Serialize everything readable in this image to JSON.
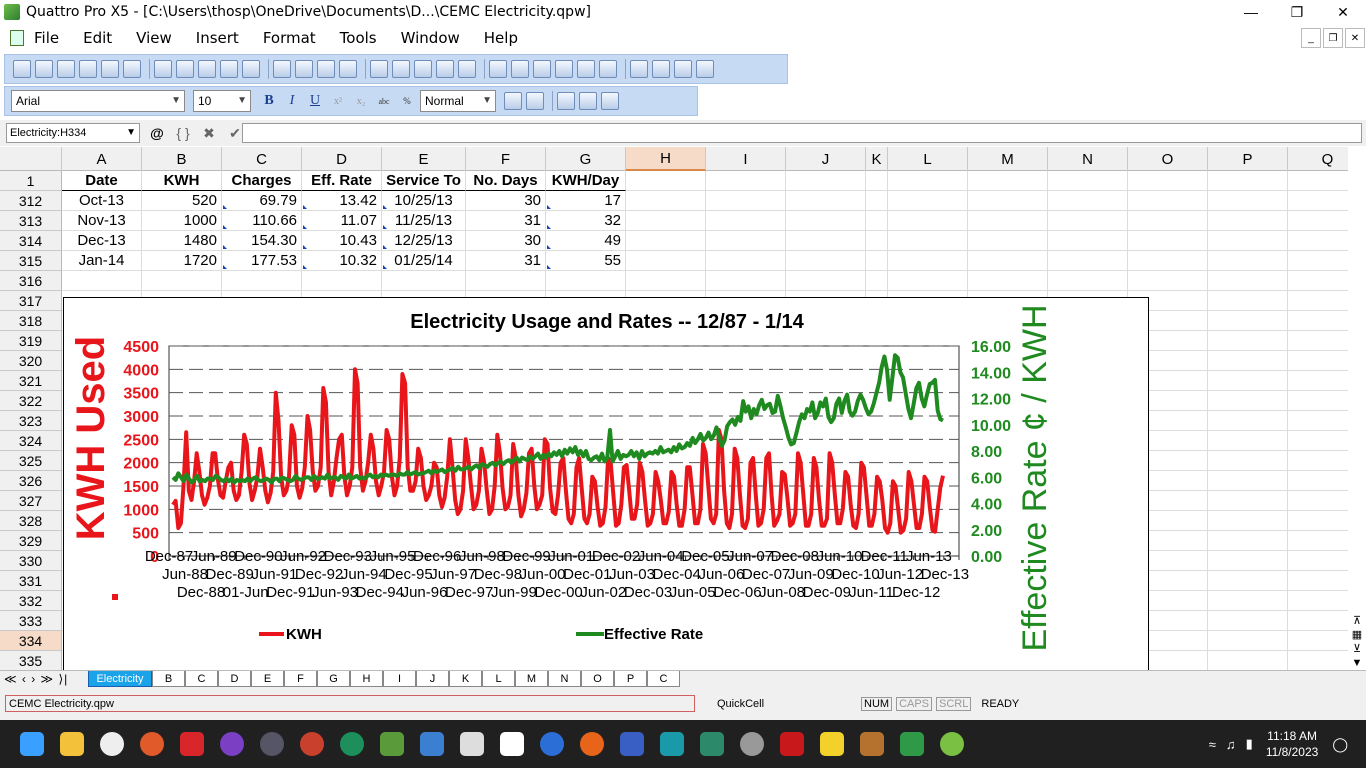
{
  "window": {
    "title": "Quattro Pro X5 - [C:\\Users\\thosp\\OneDrive\\Documents\\D...\\CEMC Electricity.qpw]"
  },
  "menu": [
    "File",
    "Edit",
    "View",
    "Insert",
    "Format",
    "Tools",
    "Window",
    "Help"
  ],
  "format_toolbar": {
    "font": "Arial",
    "size": "10",
    "style": "Normal"
  },
  "formula_bar": {
    "cell_ref": "Electricity:H334",
    "content": ""
  },
  "columns": [
    "A",
    "B",
    "C",
    "D",
    "E",
    "F",
    "G",
    "H",
    "I",
    "J",
    "K",
    "L",
    "M",
    "N",
    "O",
    "P",
    "Q"
  ],
  "selected_column": "H",
  "header_row": {
    "row": "1",
    "cells": [
      "Date",
      "KWH",
      "Charges",
      "Eff. Rate",
      "Service To",
      "No. Days",
      "KWH/Day"
    ]
  },
  "rows": [
    {
      "row": "312",
      "cells": [
        "Oct-13",
        "520",
        "69.79",
        "13.42",
        "10/25/13",
        "30",
        "17"
      ]
    },
    {
      "row": "313",
      "cells": [
        "Nov-13",
        "1000",
        "110.66",
        "11.07",
        "11/25/13",
        "31",
        "32"
      ]
    },
    {
      "row": "314",
      "cells": [
        "Dec-13",
        "1480",
        "154.30",
        "10.43",
        "12/25/13",
        "30",
        "49"
      ]
    },
    {
      "row": "315",
      "cells": [
        "Jan-14",
        "1720",
        "177.53",
        "10.32",
        "01/25/14",
        "31",
        "55"
      ]
    }
  ],
  "extra_rows": [
    "316",
    "317",
    "318",
    "319",
    "320",
    "321",
    "322",
    "323",
    "324",
    "325",
    "326",
    "327",
    "328",
    "329",
    "330",
    "331",
    "332",
    "333",
    "334",
    "335"
  ],
  "selected_row": "334",
  "chart_data": {
    "type": "line",
    "title": "Electricity Usage and Rates -- 12/87 - 1/14",
    "ylabel": "KWH Used",
    "y2label": "Effective Rate  ¢ / KWH",
    "ylim": [
      0,
      4500
    ],
    "y2lim": [
      0,
      16
    ],
    "yticks": [
      "0",
      "500",
      "1000",
      "1500",
      "2000",
      "2500",
      "3000",
      "3500",
      "4000",
      "4500"
    ],
    "y2ticks": [
      "0.00",
      "2.00",
      "4.00",
      "6.00",
      "8.00",
      "10.00",
      "12.00",
      "14.00",
      "16.00"
    ],
    "xtick_rows": [
      [
        "Dec-87",
        "Jun-89",
        "Dec-90",
        "Jun-92",
        "Dec-93",
        "Jun-95",
        "Dec-96",
        "Jun-98",
        "Dec-99",
        "Jun-01",
        "Dec-02",
        "Jun-04",
        "Dec-05",
        "Jun-07",
        "Dec-08",
        "Jun-10",
        "Dec-11",
        "Jun-13"
      ],
      [
        "Jun-88",
        "Dec-89",
        "Jun-91",
        "Dec-92",
        "Jun-94",
        "Dec-95",
        "Jun-97",
        "Dec-98",
        "Jun-00",
        "Dec-01",
        "Jun-03",
        "Dec-04",
        "Jun-06",
        "Dec-07",
        "Jun-09",
        "Dec-10",
        "Jun-12",
        "Dec-13"
      ],
      [
        "Dec-88",
        "Jun-90",
        "Dec-91",
        "Jun-93",
        "Dec-94",
        "Jun-96",
        "Dec-97",
        "Jun-99",
        "Dec-00",
        "Jun-02",
        "Dec-03",
        "Jun-05",
        "Dec-06",
        "Jun-08",
        "Dec-09",
        "Jun-11",
        "Dec-12"
      ]
    ],
    "xtick_rows_shown": [
      [
        "Dec-87",
        "Jun-89",
        "Dec-90",
        "Jun-92",
        "Dec-93",
        "Jun-95",
        "Dec-96",
        "Jun-98",
        "Dec-99",
        "Jun-01",
        "Dec-02",
        "Jun-04",
        "Dec-05",
        "Jun-07",
        "Dec-08",
        "Jun-10",
        "Dec-11",
        "Jun-13"
      ],
      [
        "Jun-88",
        "Dec-89",
        "Jun-91",
        "Dec-92",
        "Jun-94",
        "Dec-95",
        "Jun-97",
        "Dec-98",
        "Jun-00",
        "Dec-01",
        "Jun-03",
        "Dec-04",
        "Jun-06",
        "Dec-07",
        "Jun-09",
        "Dec-10",
        "Jun-12",
        "Dec-13"
      ],
      [
        "Dec-88",
        "01-Jun",
        "Dec-91",
        "Jun-93",
        "Dec-94",
        "Jun-96",
        "Dec-97",
        "Jun-99",
        "Dec-00",
        "Jun-02",
        "Dec-03",
        "Jun-05",
        "Dec-06",
        "Jun-08",
        "Dec-09",
        "Jun-11",
        "Dec-12"
      ]
    ],
    "legend": "bottom",
    "grid": true,
    "series": [
      {
        "name": "KWH",
        "color": "#e8151b",
        "axis": "left",
        "x_start": "Dec-87",
        "x_end": "Jan-14",
        "values": [
          1100,
          1180,
          600,
          700,
          1500,
          2650,
          1400,
          1200,
          1600,
          2200,
          1800,
          1300,
          1100,
          1250,
          1500,
          2200,
          2200,
          1650,
          1300,
          1250,
          1600,
          1900,
          2000,
          1400,
          1200,
          1300,
          1800,
          2600,
          2400,
          1550,
          1200,
          1400,
          1700,
          2300,
          1900,
          1400,
          1150,
          1350,
          1800,
          3500,
          2900,
          1700,
          1300,
          1400,
          1700,
          2800,
          2600,
          1500,
          1250,
          1450,
          1900,
          3000,
          2700,
          1800,
          1400,
          1500,
          1900,
          3600,
          3300,
          1800,
          1300,
          1600,
          2100,
          2500,
          2600,
          1700,
          1300,
          1500,
          1900,
          4000,
          3700,
          1900,
          1400,
          1600,
          2000,
          2600,
          2300,
          1600,
          1300,
          1500,
          1800,
          2700,
          2500,
          1700,
          1300,
          1500,
          2100,
          3900,
          3700,
          1900,
          1400,
          1400,
          1600,
          2300,
          2100,
          1500,
          1200,
          1300,
          1500,
          2000,
          1900,
          1300,
          1050,
          1250,
          1700,
          2500,
          1900,
          1200,
          900,
          1000,
          1400,
          2500,
          2100,
          1500,
          1000,
          1100,
          1400,
          2300,
          2000,
          1400,
          900,
          1000,
          1500,
          2600,
          2200,
          1450,
          1000,
          1050,
          1300,
          2400,
          2100,
          1300,
          850,
          1000,
          1350,
          2200,
          2300,
          1500,
          1000,
          1100,
          1300,
          2500,
          2400,
          1450,
          950,
          900,
          1300,
          2000,
          2100,
          1400,
          800,
          700,
          900,
          1900,
          2100,
          1450,
          800,
          700,
          900,
          1700,
          1600,
          1050,
          650,
          700,
          1050,
          2100,
          2000,
          1300,
          650,
          700,
          1100,
          1900,
          1950,
          1400,
          800,
          800,
          1100,
          2000,
          1800,
          1200,
          650,
          700,
          900,
          1800,
          1600,
          1200,
          700,
          700,
          950,
          1800,
          1700,
          1100,
          650,
          650,
          1000,
          1900,
          1900,
          1300,
          700,
          700,
          1000,
          2400,
          2200,
          1500,
          800,
          700,
          900,
          2700,
          2500,
          1400,
          700,
          600,
          900,
          2300,
          2100,
          1300,
          650,
          600,
          800,
          2000,
          2100,
          1300,
          650,
          700,
          1000,
          2100,
          2200,
          1300,
          650,
          750,
          900,
          1800,
          1750,
          1250,
          650,
          700,
          900,
          2200,
          2000,
          1350,
          650,
          650,
          900,
          2100,
          1900,
          1200,
          650,
          650,
          800,
          2200,
          2000,
          1300,
          700,
          700,
          1000,
          1800,
          1700,
          1100,
          650,
          600,
          900,
          2000,
          1900,
          1300,
          650,
          650,
          900,
          1700,
          1600,
          1200,
          600,
          500,
          700,
          1600,
          1500,
          1000,
          500,
          550,
          800,
          1800,
          1600,
          1100,
          600,
          600,
          900,
          1700,
          1600,
          1050,
          550,
          520,
          1000,
          1480,
          1720
        ]
      },
      {
        "name": "Effective Rate",
        "color": "#1f8a1f",
        "axis": "right",
        "x_start": "Dec-87",
        "x_end": "Jan-14",
        "values": [
          6.0,
          5.8,
          6.3,
          6.0,
          5.7,
          6.2,
          5.9,
          5.6,
          5.8,
          6.1,
          5.7,
          5.8,
          5.7,
          5.9,
          5.9,
          5.8,
          6.1,
          6.0,
          5.8,
          5.7,
          5.9,
          5.7,
          5.9,
          5.6,
          5.8,
          5.7,
          5.8,
          5.7,
          5.9,
          5.7,
          5.9,
          6.0,
          5.8,
          5.7,
          5.8,
          5.9,
          5.8,
          5.6,
          5.9,
          5.9,
          5.7,
          6.0,
          5.9,
          5.8,
          5.7,
          5.8,
          6.1,
          5.9,
          5.8,
          5.9,
          6.0,
          6.0,
          5.8,
          6.1,
          5.9,
          5.9,
          6.0,
          5.9,
          6.2,
          5.9,
          6.0,
          6.0,
          5.8,
          6.1,
          6.0,
          5.9,
          6.2,
          5.9,
          6.0,
          6.1,
          5.9,
          6.0,
          5.9,
          6.1,
          6.2,
          6.0,
          6.1,
          6.0,
          6.2,
          6.1,
          6.2,
          6.1,
          6.2,
          6.2,
          6.1,
          6.3,
          6.2,
          6.2,
          6.4,
          6.2,
          6.3,
          6.4,
          6.2,
          6.3,
          6.3,
          6.4,
          6.5,
          6.3,
          6.5,
          6.4,
          6.5,
          6.6,
          6.4,
          6.5,
          6.6,
          6.7,
          6.5,
          6.8,
          6.6,
          6.6,
          6.7,
          6.8,
          6.6,
          6.8,
          6.9,
          6.7,
          7.0,
          6.9,
          6.8,
          7.0,
          7.1,
          6.9,
          7.1,
          7.2,
          7.0,
          7.2,
          7.3,
          7.1,
          7.3,
          7.5,
          7.2,
          7.5,
          7.4,
          7.3,
          7.6,
          7.4,
          7.6,
          7.8,
          7.4,
          7.7,
          7.5,
          7.8,
          7.6,
          7.9,
          7.7,
          8.0,
          7.6,
          8.1,
          7.8,
          8.2,
          7.9,
          8.3,
          7.7,
          8.0,
          7.6,
          8.0,
          7.4,
          7.3,
          7.5,
          7.6,
          7.3,
          7.8,
          7.2,
          7.5,
          9.6,
          7.2,
          7.6,
          8.0,
          7.4,
          7.7,
          7.6,
          7.7,
          8.0,
          7.6,
          7.9,
          7.4,
          8.0,
          7.6,
          7.8,
          7.9,
          7.8,
          8.0,
          7.8,
          8.3,
          7.9,
          8.0,
          8.1,
          7.9,
          8.3,
          8.0,
          8.5,
          8.2,
          8.3,
          8.6,
          8.4,
          9.0,
          8.6,
          8.9,
          9.3,
          8.8,
          9.0,
          9.4,
          8.9,
          9.2,
          9.8,
          9.0,
          8.4,
          8.8,
          9.9,
          10.2,
          10.4,
          10.0,
          10.6,
          10.3,
          11.8,
          11.0,
          11.4,
          10.5,
          11.2,
          10.8,
          11.5,
          11.9,
          11.2,
          11.5,
          11.6,
          10.9,
          11.0,
          12.2,
          11.4,
          10.5,
          9.8,
          9.0,
          8.5,
          8.6,
          9.4,
          10.2,
          10.8,
          10.5,
          11.2,
          11.0,
          11.7,
          10.5,
          10.9,
          11.7,
          11.4,
          12.0,
          10.6,
          10.2,
          10.5,
          11.6,
          12.0,
          10.9,
          11.8,
          12.3,
          11.0,
          10.7,
          11.0,
          11.8,
          12.3,
          11.9,
          11.3,
          10.8,
          11.0,
          11.6,
          12.4,
          13.2,
          14.4,
          15.2,
          14.2,
          11.9,
          13.6,
          15.3,
          15.1,
          14.0,
          13.6,
          12.4,
          11.2,
          10.5,
          11.6,
          12.8,
          13.2,
          12.0,
          11.4,
          12.3,
          13.1,
          13.2,
          13.42,
          11.07,
          10.43,
          10.32
        ]
      }
    ]
  },
  "sheet_nav": "≪ ‹ › ≫ ⟩|",
  "tabs": [
    "Electricity",
    "B",
    "C",
    "D",
    "E",
    "F",
    "G",
    "H",
    "I",
    "J",
    "K",
    "L",
    "M",
    "N",
    "O",
    "P",
    "C"
  ],
  "status": {
    "filename": "CEMC Electricity.qpw",
    "quickcell": "QuickCell",
    "num": "NUM",
    "caps": "CAPS",
    "scrl": "SCRL",
    "mode": "READY"
  },
  "taskbar": {
    "time": "11:18 AM",
    "date": "11/8/2023"
  }
}
